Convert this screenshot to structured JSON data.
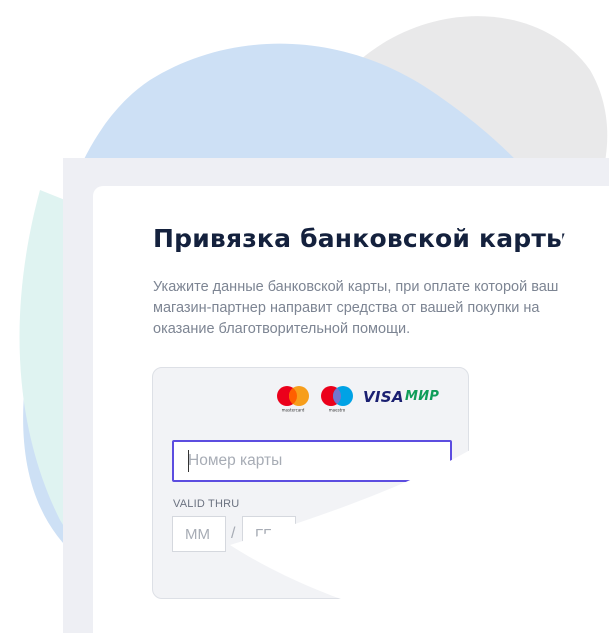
{
  "page": {
    "title": "Привязка банковской карты",
    "description": "Укажите данные банковской карты, при оплате которой ваш магазин-партнер направит средства от вашей покупки на оказание благотворительной помощи."
  },
  "payment_logos": {
    "mastercard_caption": "mastercard",
    "maestro_caption": "maestro",
    "visa": "VISA",
    "mir": "МИР"
  },
  "card_form": {
    "card_number_placeholder": "Номер карты",
    "card_number_value": "",
    "valid_thru_label": "VALID THRU",
    "month_placeholder": "ММ",
    "year_placeholder": "ГГ",
    "separator": "/"
  },
  "colors": {
    "title": "#14213d",
    "accent_border": "#5c4de0",
    "blob_blue": "#cde0f5",
    "blob_grey": "#e9e9ea",
    "blob_mint": "#dff3f1",
    "mir_green": "#0f9d58",
    "visa_blue": "#1a1f71"
  }
}
